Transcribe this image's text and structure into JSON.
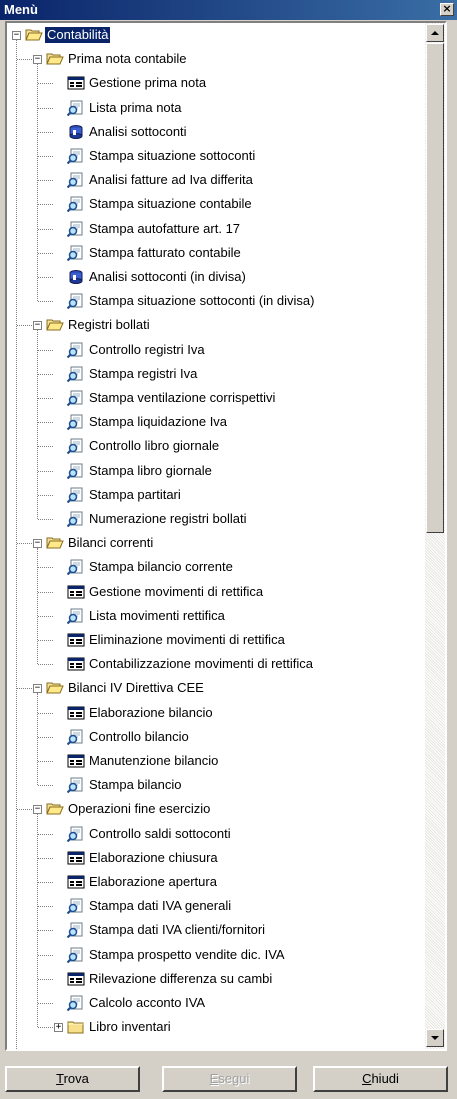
{
  "window": {
    "title": "Menù",
    "close_glyph": "×"
  },
  "tree": {
    "root": {
      "label": "Contabilità",
      "expanded": true,
      "selected": true
    },
    "groups": [
      {
        "label": "Prima nota contabile",
        "expanded": true,
        "items": [
          {
            "label": "Gestione prima nota",
            "icon": "form-icon"
          },
          {
            "label": "Lista prima nota",
            "icon": "report-icon"
          },
          {
            "label": "Analisi sottoconti",
            "icon": "analysis-icon"
          },
          {
            "label": "Stampa situazione sottoconti",
            "icon": "report-icon"
          },
          {
            "label": "Analisi fatture ad Iva differita",
            "icon": "report-icon"
          },
          {
            "label": "Stampa situazione contabile",
            "icon": "report-icon"
          },
          {
            "label": "Stampa autofatture art. 17",
            "icon": "report-icon"
          },
          {
            "label": "Stampa fatturato contabile",
            "icon": "report-icon"
          },
          {
            "label": "Analisi sottoconti (in divisa)",
            "icon": "analysis-icon"
          },
          {
            "label": "Stampa situazione sottoconti (in divisa)",
            "icon": "report-icon"
          }
        ]
      },
      {
        "label": "Registri bollati",
        "expanded": true,
        "items": [
          {
            "label": "Controllo registri Iva",
            "icon": "report-icon"
          },
          {
            "label": "Stampa registri Iva",
            "icon": "report-icon"
          },
          {
            "label": "Stampa ventilazione corrispettivi",
            "icon": "report-icon"
          },
          {
            "label": "Stampa liquidazione Iva",
            "icon": "report-icon"
          },
          {
            "label": "Controllo libro giornale",
            "icon": "report-icon"
          },
          {
            "label": "Stampa libro giornale",
            "icon": "report-icon"
          },
          {
            "label": "Stampa partitari",
            "icon": "report-icon"
          },
          {
            "label": "Numerazione registri bollati",
            "icon": "report-icon"
          }
        ]
      },
      {
        "label": "Bilanci correnti",
        "expanded": true,
        "items": [
          {
            "label": "Stampa bilancio corrente",
            "icon": "report-icon"
          },
          {
            "label": "Gestione movimenti di rettifica",
            "icon": "form-icon"
          },
          {
            "label": "Lista movimenti rettifica",
            "icon": "report-icon"
          },
          {
            "label": "Eliminazione movimenti di rettifica",
            "icon": "form-icon"
          },
          {
            "label": "Contabilizzazione movimenti di rettifica",
            "icon": "form-icon"
          }
        ]
      },
      {
        "label": "Bilanci IV Direttiva CEE",
        "expanded": true,
        "items": [
          {
            "label": "Elaborazione bilancio",
            "icon": "form-icon"
          },
          {
            "label": "Controllo bilancio",
            "icon": "report-icon"
          },
          {
            "label": "Manutenzione bilancio",
            "icon": "form-icon"
          },
          {
            "label": "Stampa bilancio",
            "icon": "report-icon"
          }
        ]
      },
      {
        "label": "Operazioni fine esercizio",
        "expanded": true,
        "items": [
          {
            "label": "Controllo saldi sottoconti",
            "icon": "report-icon"
          },
          {
            "label": "Elaborazione chiusura",
            "icon": "form-icon"
          },
          {
            "label": "Elaborazione apertura",
            "icon": "form-icon"
          },
          {
            "label": "Stampa dati IVA generali",
            "icon": "report-icon"
          },
          {
            "label": "Stampa dati IVA clienti/fornitori",
            "icon": "report-icon"
          },
          {
            "label": "Stampa prospetto vendite dic. IVA",
            "icon": "report-icon"
          },
          {
            "label": "Rilevazione differenza su cambi",
            "icon": "form-icon"
          },
          {
            "label": "Calcolo acconto IVA",
            "icon": "report-icon"
          }
        ],
        "subgroups": [
          {
            "label": "Libro inventari",
            "expanded": false
          }
        ]
      }
    ]
  },
  "buttons": {
    "find": {
      "label": "Trova",
      "accel": "T",
      "rest": "rova"
    },
    "run": {
      "label": "Esegui",
      "accel": "E",
      "rest": "segui",
      "disabled": true
    },
    "close": {
      "label": "Chiudi",
      "accel": "C",
      "rest": "hiudi"
    }
  }
}
